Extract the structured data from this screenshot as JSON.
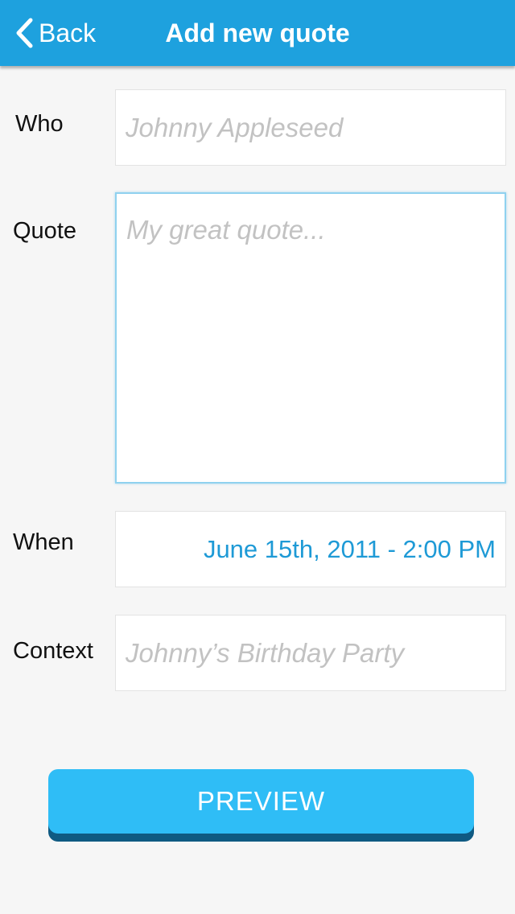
{
  "nav": {
    "back_label": "Back",
    "title": "Add new quote"
  },
  "form": {
    "who": {
      "label": "Who",
      "placeholder": "Johnny Appleseed"
    },
    "quote": {
      "label": "Quote",
      "placeholder": "My great quote..."
    },
    "when": {
      "label": "When",
      "value": "June 15th, 2011 - 2:00 PM"
    },
    "context": {
      "label": "Context",
      "placeholder": "Johnny’s Birthday Party"
    }
  },
  "actions": {
    "preview_label": "PREVIEW"
  },
  "colors": {
    "nav_background": "#1ea1de",
    "page_background": "#f6f6f6",
    "accent_text": "#1e9ad6",
    "button_background": "#2fbdf6",
    "button_shadow": "#0f5a82"
  },
  "icons": {
    "back": "chevron-left-icon"
  }
}
